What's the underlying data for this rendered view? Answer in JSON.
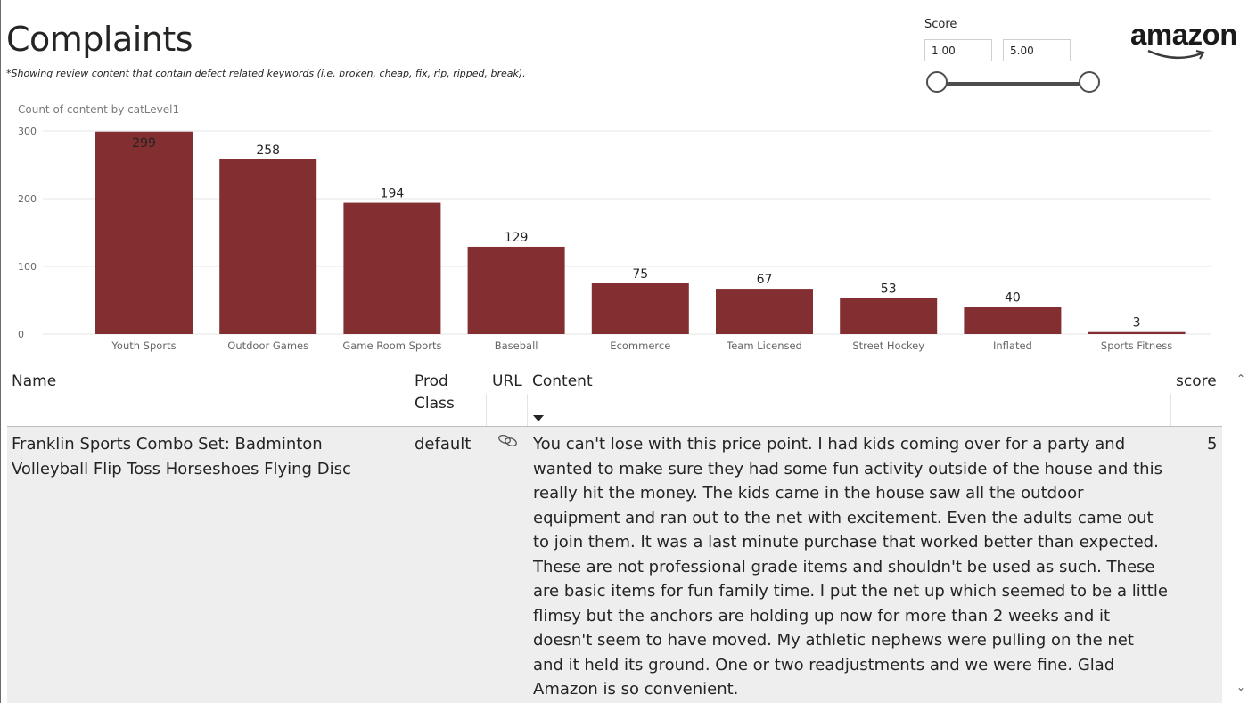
{
  "header": {
    "title": "Complaints",
    "subtitle": "*Showing review content that contain defect related keywords (i.e. broken, cheap, fix, rip, ripped, break)."
  },
  "slicer": {
    "label": "Score",
    "min_value": "1.00",
    "max_value": "5.00"
  },
  "logo": {
    "text": "amazon"
  },
  "colors": {
    "bar": "#832e30",
    "gridline": "#e6e6e6",
    "row_bg": "#eeeeee"
  },
  "chart_data": {
    "type": "bar",
    "title": "Count of content by catLevel1",
    "categories": [
      "Youth Sports",
      "Outdoor Games",
      "Game Room Sports",
      "Baseball",
      "Ecommerce",
      "Team Licensed",
      "Street Hockey",
      "Inflated",
      "Sports Fitness"
    ],
    "values": [
      299,
      258,
      194,
      129,
      75,
      67,
      53,
      40,
      3
    ],
    "ylim": [
      0,
      300
    ],
    "yticks": [
      0,
      100,
      200,
      300
    ],
    "grid": true,
    "data_labels": true
  },
  "table": {
    "columns": {
      "name": "Name",
      "prod_class_1": "Prod",
      "prod_class_2": "Class",
      "url": "URL",
      "content": "Content",
      "score": "score"
    },
    "rows": [
      {
        "name_1": "Franklin Sports Combo Set: Badminton",
        "name_2": "Volleyball Flip Toss Horseshoes Flying Disc",
        "prod_class": "default",
        "url_icon": "link-icon",
        "content_lines": [
          "You can't lose with this price point. I had kids coming over for a party and",
          "wanted to make sure they had some fun activity outside of the house and this",
          "really hit the money. The kids came in the house saw all the outdoor",
          "equipment and ran out to the net with excitement. Even the adults came out",
          "to join them. It was a last minute purchase that worked better than expected.",
          "These are not professional grade items and shouldn't be used as such. These",
          "are basic items for fun family time. I put the net up which seemed to be a little",
          "flimsy but the anchors are holding up now for more than 2 weeks and it",
          "doesn't seem to have moved. My athletic nephews were pulling on the net",
          "and it held its ground. One or two readjustments and we were fine. Glad",
          "Amazon is so convenient."
        ],
        "score": "5"
      }
    ]
  }
}
